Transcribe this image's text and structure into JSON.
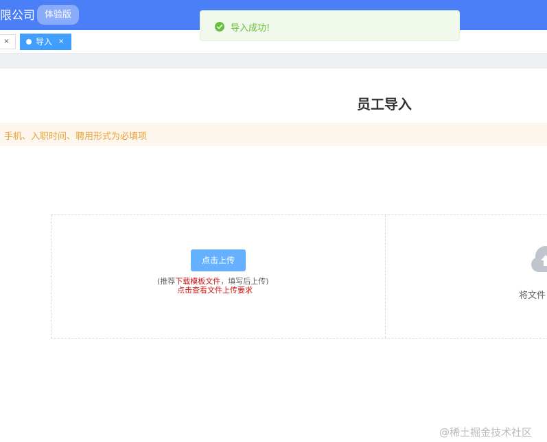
{
  "header": {
    "company_title": "限公司",
    "badge": "体验版"
  },
  "tags": {
    "prev_close": "×",
    "active": {
      "label": "导入",
      "close": "×"
    }
  },
  "page": {
    "title": "员工导入",
    "alert": "手机、入职时间、聘用形式为必填项"
  },
  "upload": {
    "button_label": "点击上传",
    "hint_prefix": "(推荐",
    "hint_link": "下载模板文件",
    "hint_suffix": "，填写后上传)",
    "requirements_link": "点击查看文件上传要求",
    "drop_text": "将文件"
  },
  "toast": {
    "message": "导入成功!"
  },
  "watermark": "@稀土掘金技术社区",
  "colors": {
    "header": "#4a7ff7",
    "tag_active": "#409eff",
    "button": "#66b1ff",
    "alert_text": "#e6a23c",
    "link_red": "#d01414",
    "success": "#67c23a"
  },
  "icons": {
    "toast": "check-circle-icon",
    "upload": "cloud-upload-icon"
  }
}
